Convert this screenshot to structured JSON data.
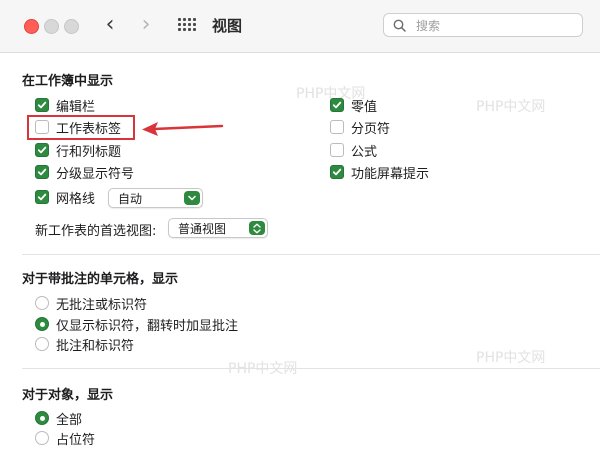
{
  "window": {
    "title": "视图",
    "search_placeholder": "搜索"
  },
  "section_show_in_workbook": {
    "title": "在工作簿中显示",
    "left_items": [
      {
        "label": "编辑栏",
        "checked": true
      },
      {
        "label": "工作表标签",
        "checked": false
      },
      {
        "label": "行和列标题",
        "checked": true
      },
      {
        "label": "分级显示符号",
        "checked": true
      },
      {
        "label": "网格线",
        "checked": true
      }
    ],
    "gridline_select": "自动",
    "right_items": [
      {
        "label": "零值",
        "checked": true
      },
      {
        "label": "分页符",
        "checked": false
      },
      {
        "label": "公式",
        "checked": false
      },
      {
        "label": "功能屏幕提示",
        "checked": true
      }
    ],
    "preferred_view_label": "新工作表的首选视图:",
    "preferred_view_value": "普通视图"
  },
  "section_comments": {
    "title": "对于带批注的单元格，显示",
    "options": [
      {
        "label": "无批注或标识符",
        "selected": false
      },
      {
        "label": "仅显示标识符，翻转时加显批注",
        "selected": true
      },
      {
        "label": "批注和标识符",
        "selected": false
      }
    ]
  },
  "section_objects": {
    "title": "对于对象，显示",
    "options": [
      {
        "label": "全部",
        "selected": true
      },
      {
        "label": "占位符",
        "selected": false
      }
    ]
  },
  "watermarks": [
    "PHP中文网",
    "PHP中文网",
    "PHP中文网",
    "PHP中文网"
  ],
  "colors": {
    "accent_green": "#2d8a3f",
    "highlight_red": "#d9343a"
  }
}
